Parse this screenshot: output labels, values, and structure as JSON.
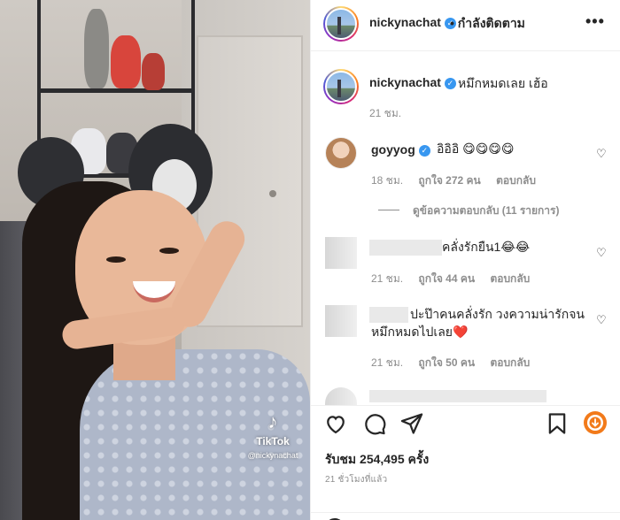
{
  "media": {
    "watermark": {
      "brand": "TikTok",
      "user": "@nickynachat",
      "logo_icon": "tiktok-icon"
    }
  },
  "header": {
    "username": "nickynachat",
    "verified_icon": "verified-badge-icon",
    "separator": "•",
    "follow_status": "กำลังติดตาม",
    "more_icon": "more-options-icon",
    "more_glyph": "•••"
  },
  "caption": {
    "username": "nickynachat",
    "text": "หมึกหมดเลย เฮ้อ",
    "time": "21 ชม."
  },
  "comments": [
    {
      "username": "goyyog",
      "verified": true,
      "text": "อิอิอิ 😋😋😋😋",
      "time": "18 ชม.",
      "likes": "ถูกใจ 272 คน",
      "reply": "ตอบกลับ"
    },
    {
      "username": "",
      "text": "คลั่งรักยืน1😂😂",
      "time": "21 ชม.",
      "likes": "ถูกใจ 44 คน",
      "reply": "ตอบกลับ"
    },
    {
      "username": "",
      "text_line1": "ปะป๊าคนคลั่งรัก วงความน่ารักจน",
      "text_line2": "หมึกหมดไปเลย❤️",
      "time": "21 ชม.",
      "likes": "ถูกใจ 50 คน",
      "reply": "ตอบกลับ"
    }
  ],
  "view_replies": "ดูข้อความตอบกลับ (11 รายการ)",
  "actions": {
    "icons": [
      "heart-icon",
      "comment-icon",
      "share-icon",
      "bookmark-icon",
      "reel-download-icon"
    ],
    "views": "รับชม 254,495 ครั้ง",
    "posted": "21 ชั่วโมงที่แล้ว"
  },
  "colors": {
    "verified": "#3897f0",
    "muted": "#8e8e8e",
    "text": "#262626",
    "accent": "#f27a1a"
  }
}
